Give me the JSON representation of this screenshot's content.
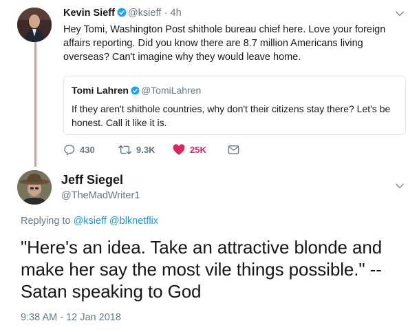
{
  "tweet1": {
    "author_name": "Kevin Sieff",
    "author_handle": "@ksieff",
    "time": "· 4h",
    "text": "Hey Tomi, Washington Post shithole bureau chief here. Love your foreign affairs reporting. Did you know there are 8.7 million Americans living overseas? Can't imagine why they would leave home.",
    "quoted": {
      "author_name": "Tomi Lahren",
      "author_handle": "@TomiLahren",
      "text": "If they aren't shithole countries, why don't their citizens stay there? Let's be honest. Call it like it is."
    },
    "actions": {
      "reply_count": "430",
      "retweet_count": "9.3K",
      "like_count": "25K"
    }
  },
  "tweet2": {
    "author_name": "Jeff Siegel",
    "author_handle": "@TheMadWriter1",
    "replying_prefix": "Replying to",
    "replying_to": [
      "@ksieff",
      "@blknetflix"
    ],
    "text": "\"Here's an idea. Take an attractive blonde and make her say the most vile things possible.\" -- Satan speaking to God",
    "timestamp": "9:38 AM - 12 Jan 2018"
  },
  "colors": {
    "link": "#1b95e0",
    "like": "#e0245e",
    "muted": "#657786",
    "thread_line": "#c8a09c",
    "verified": "#1da1f2"
  },
  "icons": [
    "verified-badge-icon",
    "chevron-down-icon",
    "reply-icon",
    "retweet-icon",
    "heart-icon",
    "envelope-icon"
  ]
}
